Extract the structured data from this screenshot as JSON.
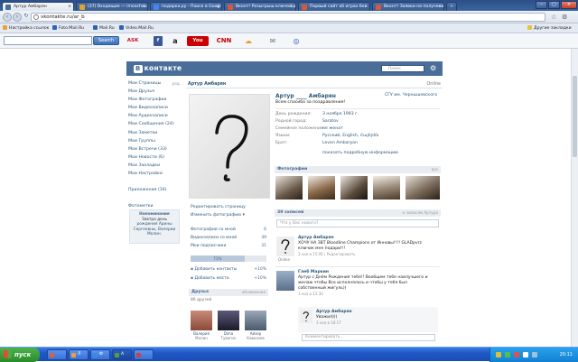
{
  "browser": {
    "tabs": [
      {
        "label": "Артур Амбарян",
        "active": true,
        "color": "#4a6e99"
      },
      {
        "label": "(37) Входящие — imoochno",
        "active": false,
        "color": "#e0a230"
      },
      {
        "label": "подарка.ру - Поиск в Googl",
        "active": false,
        "color": "#4285f4"
      },
      {
        "label": "Вконт! Розыгрыш ключей д",
        "active": false,
        "color": "#d65a3a"
      },
      {
        "label": "Первый сайт об играх без",
        "active": false,
        "color": "#d65a3a"
      },
      {
        "label": "Вконт! Заявки на получени",
        "active": false,
        "color": "#d65a3a"
      }
    ],
    "url": "vkontakte.ru/ar_b"
  },
  "bookmarks": [
    {
      "label": "Настройка ссылок",
      "color": "#e8a23a"
    },
    {
      "label": "Foto.Mail.Ru",
      "color": "#2a62b8"
    },
    {
      "label": "Mail.Ru",
      "color": "#2a62b8"
    },
    {
      "label": "Video.Mail.Ru",
      "color": "#2a62b8"
    }
  ],
  "other_bookmarks": "Другие закладки",
  "toolbar": {
    "search_button": "Search",
    "icons": [
      {
        "name": "ask-icon",
        "glyph": "ASK",
        "color": "#c8102e"
      },
      {
        "name": "facebook-icon",
        "glyph": "f",
        "color": "#3b5998"
      },
      {
        "name": "amazon-icon",
        "glyph": "a",
        "color": "#222222"
      },
      {
        "name": "youtube-icon",
        "glyph": "You",
        "color": "#cc0000"
      },
      {
        "name": "cnn-icon",
        "glyph": "CNN",
        "color": "#cc0000"
      },
      {
        "name": "weather-icon",
        "glyph": "☁",
        "color": "#e0a020"
      },
      {
        "name": "chat-icon",
        "glyph": "✉",
        "color": "#777777"
      },
      {
        "name": "radio-icon",
        "glyph": "◎",
        "color": "#2a5fa8"
      }
    ]
  },
  "vk": {
    "logo": "контакте",
    "logo_b": "В",
    "search_placeholder": "Поиск",
    "nav": [
      {
        "label": "Мои Страницы",
        "extra": "ред."
      },
      {
        "label": "Мои Друзья",
        "extra": ""
      },
      {
        "label": "Мои Фотографии",
        "extra": ""
      },
      {
        "label": "Мои Видеозаписи",
        "extra": ""
      },
      {
        "label": "Мои Аудиозаписи",
        "extra": ""
      },
      {
        "label": "Мои Сообщения (24)",
        "extra": ""
      },
      {
        "label": "Мои Заметки",
        "extra": ""
      },
      {
        "label": "Мои Группы",
        "extra": ""
      },
      {
        "label": "Мои Встречи (33)",
        "extra": ""
      },
      {
        "label": "Мои Новости (6)",
        "extra": ""
      },
      {
        "label": "Мои Закладки",
        "extra": ""
      },
      {
        "label": "Мои Настройки",
        "extra": ""
      },
      {
        "label": "",
        "extra": ""
      },
      {
        "label": "Приложения (16)",
        "extra": ""
      },
      {
        "label": "",
        "extra": ""
      },
      {
        "label": "Фотометки",
        "extra": ""
      }
    ],
    "reminder": {
      "title": "Напоминание",
      "text1": "Завтра день",
      "text2": "рождения Арины",
      "text3": "Сергеевны, Валерии",
      "text4": "Молин."
    },
    "profile": {
      "header_name": "Артур Амбарян",
      "online": "Online",
      "full_name": "Артур ____ Амбарян",
      "status": "Всем спасибо за поздравления!",
      "school": "СГУ им. Чернышевского",
      "info": [
        {
          "k": "День рождения:",
          "v": "3 ноября 1993 г."
        },
        {
          "k": "Родной город:",
          "v": "Saratov"
        },
        {
          "k": "Семейное положение:",
          "v": "не женат"
        },
        {
          "k": "Языки:",
          "v": "Русский, English, Հայերեն"
        },
        {
          "k": "Брат:",
          "v": "Levon Ambaryan"
        }
      ],
      "more": "показать подробную информацию",
      "edit_page": "Редактировать страницу",
      "change_photo": "Изменить фотографию",
      "photos_with_me": {
        "label": "Фотографии со мной",
        "n": "6"
      },
      "videos_with_me": {
        "label": "Видеозаписи со мной",
        "n": "39"
      },
      "subscribers": {
        "label": "Мои подписчики",
        "n": "31"
      },
      "progress": {
        "label": "71%",
        "value": 0.71
      },
      "add_contacts": {
        "label": "Добавить контакты",
        "n": "+10%"
      },
      "add_places": {
        "label": "Добавить места",
        "n": "+10%"
      },
      "friends": {
        "title": "Друзья",
        "right": "обновления",
        "count": "86 друзей",
        "list": [
          {
            "name": "Валерия",
            "sub": "Молин",
            "color": "#b06a5a"
          },
          {
            "name": "Dima",
            "sub": "Тувагин",
            "color": "#3a3a5a"
          },
          {
            "name": "Айзер",
            "sub": "Кавказов",
            "color": "#6a7a8a"
          }
        ]
      }
    },
    "photos": {
      "title": "Фотографии",
      "right": "все"
    },
    "wall": {
      "title": "39 записей",
      "right": "к записям Артура",
      "placeholder": "Что у Вас нового?",
      "posts": [
        {
          "author": "Артур Амбарян",
          "text1": "ХОЧУ НА ЗВТ Bloodline Champions от Инновы!!!! GLADpvrz",
          "text2": "ключик мне подари!!!",
          "meta": "3 ноя в 15:06 | Редактировать",
          "avatar_label": "Online"
        },
        {
          "author": "Глеб Маркин",
          "text1": "Артур с Днём Рождения тебя!! Вообщем тебе наилучшего и",
          "text2": "желаю чтобы Все исполнялось и чтобы у тебя был",
          "text3": "собственный жигуль))",
          "meta": "3 ноя в 22:36"
        },
        {
          "author": "Артур Амбарян",
          "text1": "Уважил)))",
          "meta": "3 ноя в 18:17"
        }
      ],
      "comment_placeholder": "Комментировать..."
    }
  },
  "taskbar": {
    "start": "пуск",
    "clock": "20:11",
    "buttons": [
      {
        "label": "",
        "color": "#e06030"
      },
      {
        "label": "Л",
        "color": "#f0a030"
      },
      {
        "label": "Ф",
        "color": "#3a8ae0"
      },
      {
        "label": "A",
        "color": "#5a9a3a"
      },
      {
        "label": "",
        "color": "#d04040"
      }
    ]
  }
}
